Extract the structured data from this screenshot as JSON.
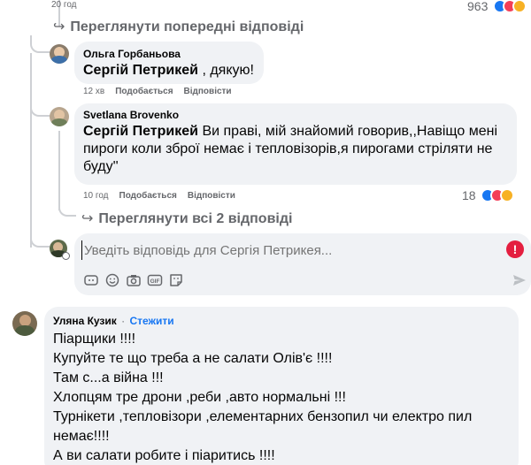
{
  "top": {
    "time": "20 год",
    "count": "963"
  },
  "view_prev": "Переглянути попередні відповіді",
  "comment1": {
    "author": "Ольга Горбаньова",
    "mention": "Сергій Петрикей",
    "text": " , дякую!",
    "time": "12 хв",
    "like": "Подобається",
    "reply": "Відповісти"
  },
  "comment2": {
    "author": "Svetlana Brovenko",
    "mention": "Сергій Петрикей",
    "text": " Ви праві, мій знайомий говорив,,Навіщо мені пироги коли зброї немає і тепловізорів,я пирогами стріляти не буду''",
    "time": "10 год",
    "like": "Подобається",
    "reply": "Відповісти",
    "count": "18"
  },
  "view_all": "Переглянути всі 2 відповіді",
  "reply_input": {
    "placeholder": "Уведіть відповідь для Сергія Петрикея..."
  },
  "comment3": {
    "author": "Уляна Кузик",
    "separator": "·",
    "follow": "Стежити",
    "lines": [
      "Піарщики !!!!",
      "Купуйте те що треба а не салати Олів'є !!!!",
      "Там с...а війна !!!",
      "Хлопцям тре дрони ,реби ,авто нормальні !!!",
      "Турнікети ,тепловізори ,елементарних бензопил чи електро пил немає!!!!",
      "А ви салати робите і піаритись !!!!"
    ]
  },
  "colors": {
    "link": "#1877f2",
    "bubble": "#f0f2f5",
    "muted": "#65676b",
    "error": "#e41e3f"
  }
}
